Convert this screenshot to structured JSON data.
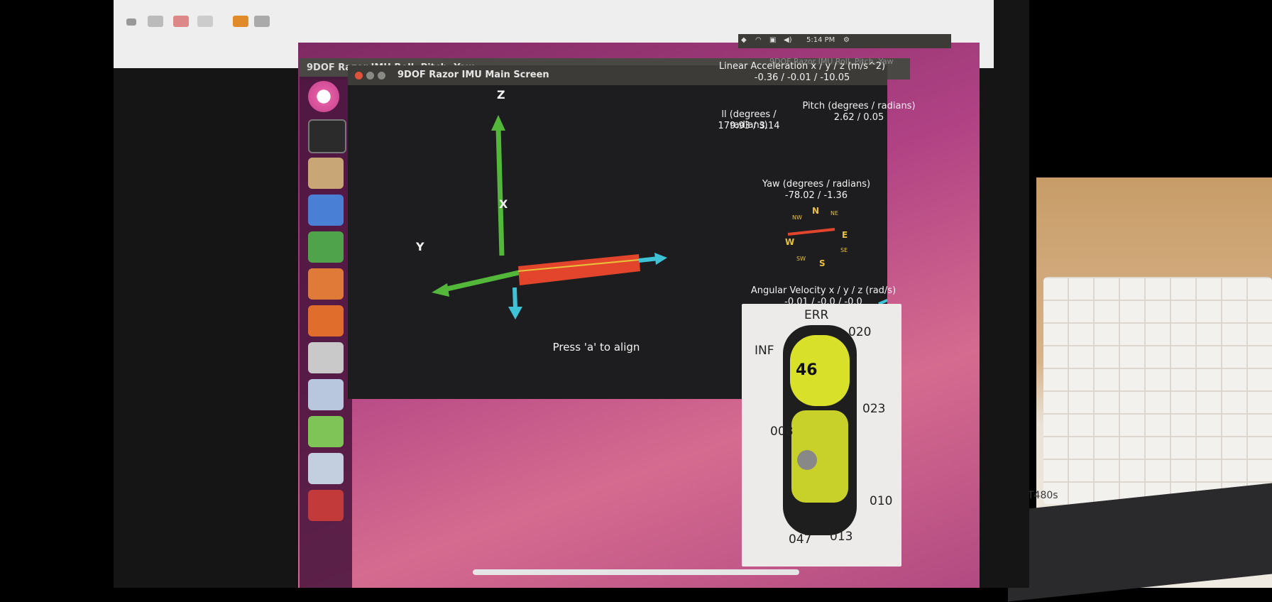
{
  "main_window": {
    "title": "9DOF Razor IMU Main Screen",
    "prompt": "Press 'a' to align"
  },
  "back_window": {
    "title": "9DOF Razor IMU Roll, Pitch, Yaw",
    "ghost_title": "9DOF Razor IMU Roll, Pitch, Yaw"
  },
  "top_panel": {
    "time": "5:14 PM"
  },
  "axes": {
    "z": "Z",
    "x": "X",
    "y": "Y"
  },
  "readouts": {
    "linear_accel_label": "Linear Acceleration x / y / z (m/s^2)",
    "linear_accel_value": "-0.36 / -0.01 / -10.05",
    "roll_label": "ll (degrees / radians)",
    "roll_value": "179.93 / 3.14",
    "pitch_label": "Pitch (degrees / radians)",
    "pitch_value": "2.62 / 0.05",
    "yaw_label": "Yaw (degrees / radians)",
    "yaw_value": "-78.02 / -1.36",
    "angular_vel_label": "Angular Velocity x / y / z (rad/s)",
    "angular_vel_value": "-0.01 / -0.0 / -0.0"
  },
  "compass": {
    "n": "N",
    "e": "E",
    "s": "S",
    "w": "W",
    "nw": "NW",
    "ne": "NE",
    "sw": "SW",
    "se": "SE"
  },
  "car_overlay": {
    "numbers": [
      "ERR",
      "020",
      "INF",
      "023",
      "008",
      "010",
      "047",
      "013"
    ]
  },
  "colors": {
    "axis_green": "#53b83a",
    "axis_cyan": "#3ec3d6",
    "board_red": "#e2452c",
    "compass_yellow": "#e8c13a",
    "desktop_magenta": "#b04284",
    "launcher_purple": "#6a1e56"
  },
  "device": {
    "brand": "T480s"
  }
}
